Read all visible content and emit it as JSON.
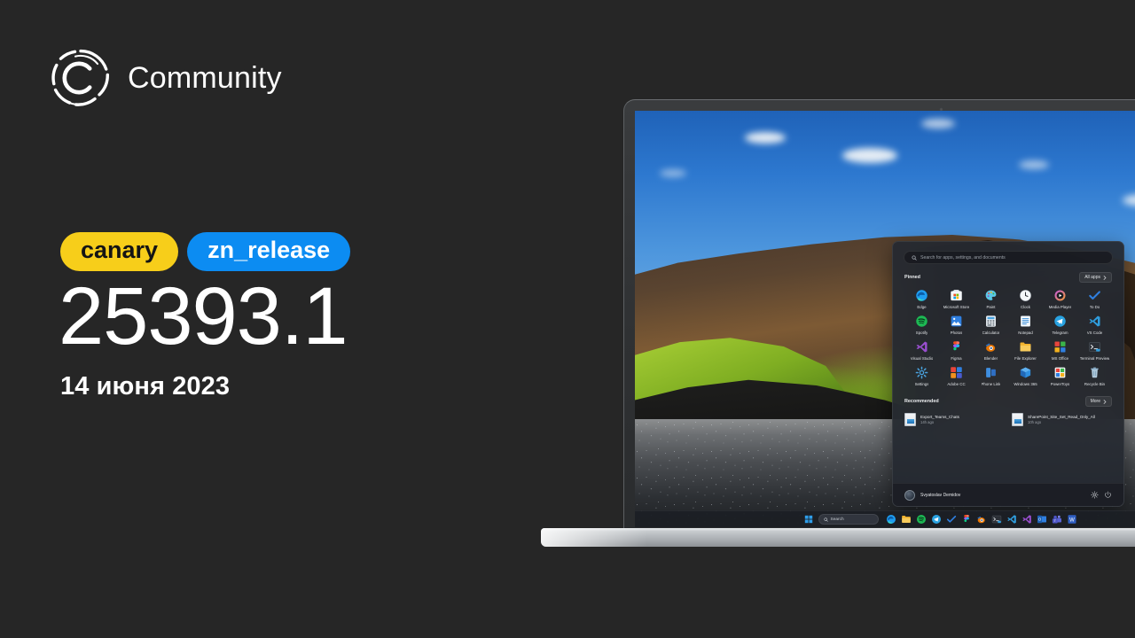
{
  "brand": {
    "name": "Community",
    "logo_icon": "community-c-ring-logo"
  },
  "release": {
    "badges": [
      {
        "label": "canary",
        "bg": "#F7CE1A",
        "fg": "#141414"
      },
      {
        "label": "zn_release",
        "bg": "#0C8CF2",
        "fg": "#FFFFFF"
      }
    ],
    "build_number": "25393.1",
    "date": "14 июня 2023"
  },
  "start_menu": {
    "search_placeholder": "Search for apps, settings, and documents",
    "search_icon": "search-icon",
    "pinned": {
      "title": "Pinned",
      "all_apps_label": "All apps",
      "all_apps_icon": "chevron-right-icon",
      "apps": [
        {
          "label": "Edge",
          "icon": "edge-icon"
        },
        {
          "label": "Microsoft Store",
          "icon": "microsoft-store-icon"
        },
        {
          "label": "Paint",
          "icon": "paint-icon"
        },
        {
          "label": "Clock",
          "icon": "clock-icon"
        },
        {
          "label": "Media Player",
          "icon": "media-player-icon"
        },
        {
          "label": "To Do",
          "icon": "to-do-icon"
        },
        {
          "label": "Spotify",
          "icon": "spotify-icon"
        },
        {
          "label": "Photos",
          "icon": "photos-icon"
        },
        {
          "label": "Calculator",
          "icon": "calculator-icon"
        },
        {
          "label": "Notepad",
          "icon": "notepad-icon"
        },
        {
          "label": "Telegram",
          "icon": "telegram-icon"
        },
        {
          "label": "VS Code",
          "icon": "vs-code-icon"
        },
        {
          "label": "Visual Studio",
          "icon": "visual-studio-icon"
        },
        {
          "label": "Figma",
          "icon": "figma-icon"
        },
        {
          "label": "Blender",
          "icon": "blender-icon"
        },
        {
          "label": "File Explorer",
          "icon": "file-explorer-icon"
        },
        {
          "label": "MS Office",
          "icon": "ms-office-icon"
        },
        {
          "label": "Terminal Preview",
          "icon": "terminal-preview-icon"
        },
        {
          "label": "Settings",
          "icon": "settings-gear-icon"
        },
        {
          "label": "Adobe CC",
          "icon": "adobe-cc-icon"
        },
        {
          "label": "Phone Link",
          "icon": "phone-link-icon"
        },
        {
          "label": "Windows 365",
          "icon": "windows-365-icon"
        },
        {
          "label": "PowerToys",
          "icon": "powertoys-icon"
        },
        {
          "label": "Recycle Bin",
          "icon": "recycle-bin-icon"
        }
      ]
    },
    "recommended": {
      "title": "Recommended",
      "more_label": "More",
      "more_icon": "chevron-right-icon",
      "items": [
        {
          "name": "Export_Teams_Chats",
          "time": "14h ago",
          "icon": "document-file-icon"
        },
        {
          "name": "SharePoint_Site_Set_Read_Only_All",
          "time": "10h ago",
          "icon": "document-file-icon"
        }
      ]
    },
    "footer": {
      "user_name": "Svyatoslav Demidov",
      "avatar_icon": "user-avatar",
      "settings_icon": "gear-icon",
      "power_icon": "power-icon"
    }
  },
  "taskbar": {
    "start_icon": "windows-start-icon",
    "search_label": "Search",
    "search_icon": "search-icon",
    "items": [
      {
        "icon": "edge-icon"
      },
      {
        "icon": "file-explorer-icon"
      },
      {
        "icon": "spotify-icon"
      },
      {
        "icon": "telegram-icon"
      },
      {
        "icon": "to-do-icon"
      },
      {
        "icon": "figma-icon"
      },
      {
        "icon": "blender-icon"
      },
      {
        "icon": "terminal-preview-icon"
      },
      {
        "icon": "vs-code-icon"
      },
      {
        "icon": "visual-studio-icon"
      },
      {
        "icon": "outlook-icon"
      },
      {
        "icon": "teams-icon"
      },
      {
        "icon": "word-icon"
      }
    ]
  },
  "device": {
    "webcam_icon": "webcam-dot",
    "type": "laptop"
  }
}
